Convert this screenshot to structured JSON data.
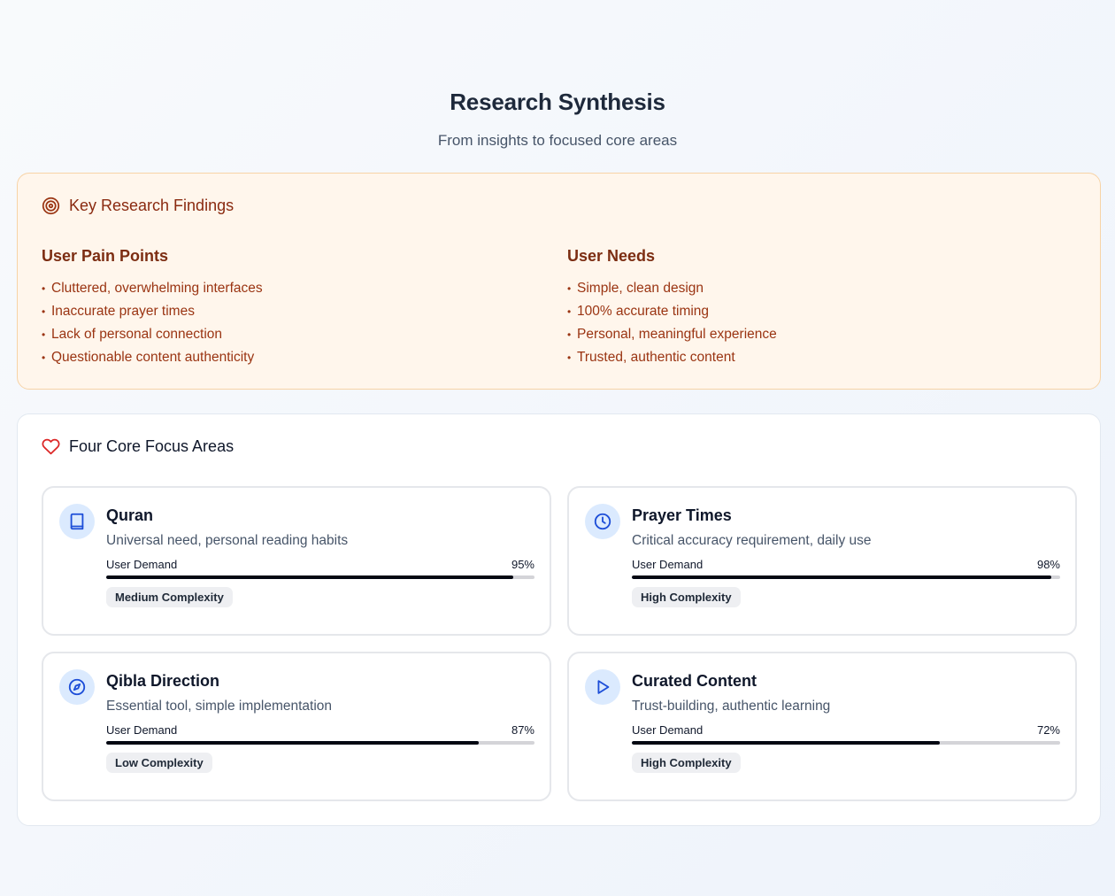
{
  "header": {
    "title": "Research Synthesis",
    "subtitle": "From insights to focused core areas"
  },
  "findings": {
    "heading": "Key Research Findings",
    "icon": "target-icon",
    "pain_points": {
      "title": "User Pain Points",
      "items": [
        "Cluttered, overwhelming interfaces",
        "Inaccurate prayer times",
        "Lack of personal connection",
        "Questionable content authenticity"
      ]
    },
    "needs": {
      "title": "User Needs",
      "items": [
        "Simple, clean design",
        "100% accurate timing",
        "Personal, meaningful experience",
        "Trusted, authentic content"
      ]
    }
  },
  "focus": {
    "heading": "Four Core Focus Areas",
    "icon": "heart-icon",
    "cards": [
      {
        "title": "Quran",
        "description": "Universal need, personal reading habits",
        "demand_label": "User Demand",
        "demand_text": "95%",
        "demand": 95,
        "complexity": "Medium Complexity",
        "icon": "book-icon"
      },
      {
        "title": "Prayer Times",
        "description": "Critical accuracy requirement, daily use",
        "demand_label": "User Demand",
        "demand_text": "98%",
        "demand": 98,
        "complexity": "High Complexity",
        "icon": "clock-icon"
      },
      {
        "title": "Qibla Direction",
        "description": "Essential tool, simple implementation",
        "demand_label": "User Demand",
        "demand_text": "87%",
        "demand": 87,
        "complexity": "Low Complexity",
        "icon": "compass-icon"
      },
      {
        "title": "Curated Content",
        "description": "Trust-building, authentic learning",
        "demand_label": "User Demand",
        "demand_text": "72%",
        "demand": 72,
        "complexity": "High Complexity",
        "icon": "play-icon"
      }
    ]
  },
  "colors": {
    "findings_bg": "#fff6ec",
    "findings_text": "#9a3412",
    "icon_bg": "#dbeafe",
    "icon_blue": "#1d4ed8",
    "heart_red": "#dc2626",
    "bar_fill": "#030712"
  }
}
